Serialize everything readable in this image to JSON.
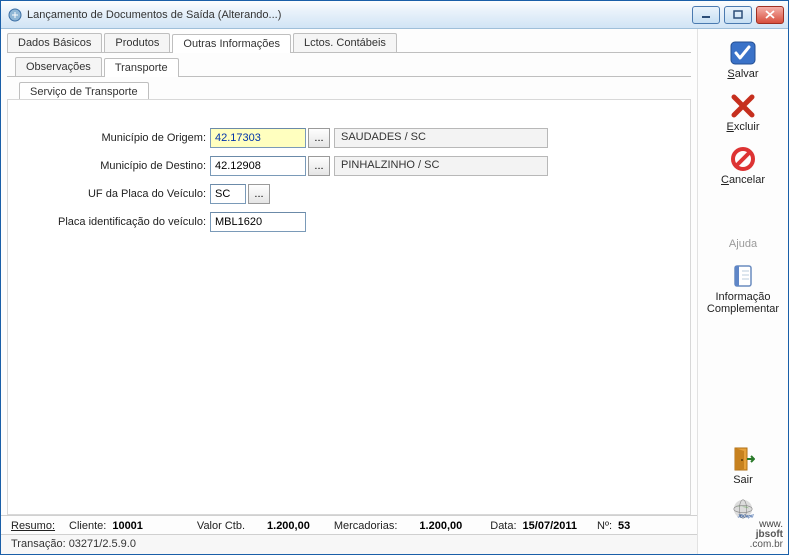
{
  "window": {
    "title": "Lançamento de Documentos de Saída (Alterando...)"
  },
  "tabs_main": [
    {
      "label": "Dados Básicos"
    },
    {
      "label": "Produtos"
    },
    {
      "label": "Outras Informações"
    },
    {
      "label": "Lctos. Contábeis"
    }
  ],
  "tabs_sub": [
    {
      "label": "Observações"
    },
    {
      "label": "Transporte"
    }
  ],
  "tabs_inner": [
    {
      "label": "Serviço de Transporte"
    }
  ],
  "form": {
    "origem_label": "Município de Origem:",
    "origem_value": "42.17303",
    "origem_display": "SAUDADES / SC",
    "destino_label": "Município de Destino:",
    "destino_value": "42.12908",
    "destino_display": "PINHALZINHO / SC",
    "uf_label": "UF da Placa do Veículo:",
    "uf_value": "SC",
    "placa_label": "Placa identificação do veículo:",
    "placa_value": "MBL1620",
    "ellipsis": "..."
  },
  "sidebar": {
    "salvar": "Salvar",
    "excluir": "Excluir",
    "cancelar": "Cancelar",
    "ajuda": "Ajuda",
    "info": "Informação Complementar",
    "sair": "Sair"
  },
  "summary": {
    "resumo_label": "Resumo:",
    "cliente_label": "Cliente:",
    "cliente_value": "10001",
    "valorctb_label": "Valor Ctb.",
    "valorctb_value": "1.200,00",
    "merc_label": "Mercadorias:",
    "merc_value": "1.200,00",
    "data_label": "Data:",
    "data_value": "15/07/2011",
    "num_label": "Nº:",
    "num_value": "53"
  },
  "status": {
    "trans_label": "Transação:",
    "trans_value": "03271/2.5.9.0"
  },
  "brand": {
    "line1": "www.",
    "line2": "jbsoft",
    "line3": ".com.br",
    "name": "JBCepil"
  }
}
